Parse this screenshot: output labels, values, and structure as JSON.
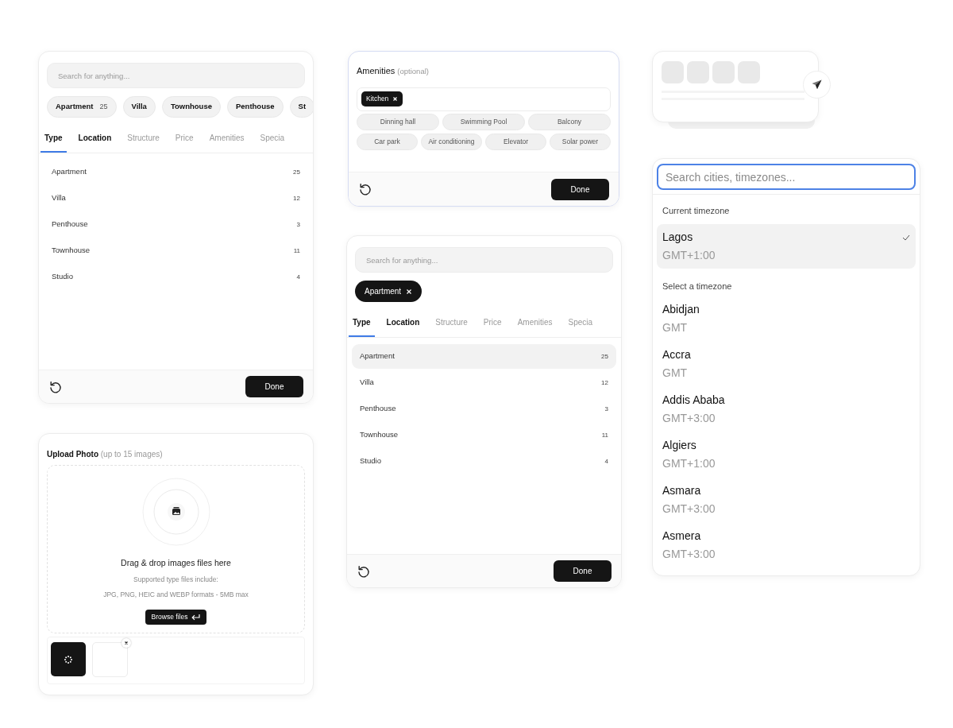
{
  "type_filter_panel": {
    "search": {
      "placeholder": "Search for anything..."
    },
    "chips": [
      {
        "label": "Apartment",
        "count": "25"
      },
      {
        "label": "Villa"
      },
      {
        "label": "Townhouse"
      },
      {
        "label": "Penthouse"
      },
      {
        "label": "St"
      }
    ],
    "tabs": [
      {
        "label": "Type",
        "selected": true,
        "muted": false
      },
      {
        "label": "Location",
        "selected": false,
        "muted": false
      },
      {
        "label": "Structure",
        "selected": false,
        "muted": true
      },
      {
        "label": "Price",
        "selected": false,
        "muted": true
      },
      {
        "label": "Amenities",
        "selected": false,
        "muted": true
      },
      {
        "label": "Specia",
        "selected": false,
        "muted": true
      }
    ],
    "items": [
      {
        "label": "Apartment",
        "count": "25",
        "selected": false
      },
      {
        "label": "Villa",
        "count": "12",
        "selected": false
      },
      {
        "label": "Penthouse",
        "count": "3",
        "selected": false
      },
      {
        "label": "Townhouse",
        "count": "11",
        "selected": false
      },
      {
        "label": "Studio",
        "count": "4",
        "selected": false
      }
    ],
    "done_button": "Done"
  },
  "upload_panel": {
    "title": "Upload Photo",
    "hint": "(up to 15 images)",
    "headline": "Drag & drop images files here",
    "note_1": "Supported type files include:",
    "note_2": "JPG, PNG, HEIC and WEBP formats - 5MB max",
    "browse_button": "Browse files",
    "thumbnails": [
      {
        "kind": "loading"
      },
      {
        "kind": "empty"
      }
    ]
  },
  "amenities_panel": {
    "title": "Amenities",
    "hint": "(optional)",
    "selected_tags": [
      {
        "label": "Kitchen"
      }
    ],
    "options": [
      {
        "label": "Dinning hall"
      },
      {
        "label": "Swimming Pool"
      },
      {
        "label": "Balcony"
      },
      {
        "label": "Car park"
      },
      {
        "label": "Air conditioning"
      },
      {
        "label": "Elevator"
      },
      {
        "label": "Solar power"
      }
    ],
    "done_button": "Done"
  },
  "selected_filter_panel": {
    "search": {
      "placeholder": "Search for anything..."
    },
    "chips": [
      {
        "label": "Apartment"
      }
    ],
    "tabs": [
      {
        "label": "Type",
        "selected": true,
        "muted": false
      },
      {
        "label": "Location",
        "selected": false,
        "muted": false
      },
      {
        "label": "Structure",
        "selected": false,
        "muted": true
      },
      {
        "label": "Price",
        "selected": false,
        "muted": true
      },
      {
        "label": "Amenities",
        "selected": false,
        "muted": true
      },
      {
        "label": "Specia",
        "selected": false,
        "muted": true
      }
    ],
    "items": [
      {
        "label": "Apartment",
        "count": "25",
        "selected": true
      },
      {
        "label": "Villa",
        "count": "12",
        "selected": false
      },
      {
        "label": "Penthouse",
        "count": "3",
        "selected": false
      },
      {
        "label": "Townhouse",
        "count": "11",
        "selected": false
      },
      {
        "label": "Studio",
        "count": "4",
        "selected": false
      }
    ],
    "done_button": "Done"
  },
  "timezone_panel": {
    "search": {
      "placeholder": "Search cities, timezones..."
    },
    "current_heading": "Current timezone",
    "current": [
      {
        "city": "Lagos",
        "offset": "GMT+1:00",
        "selected": true
      }
    ],
    "list_heading": "Select a timezone",
    "timezones": [
      {
        "city": "Abidjan",
        "offset": "GMT",
        "selected": false
      },
      {
        "city": "Accra",
        "offset": "GMT",
        "selected": false
      },
      {
        "city": "Addis Ababa",
        "offset": "GMT+3:00",
        "selected": false
      },
      {
        "city": "Algiers",
        "offset": "GMT+1:00",
        "selected": false
      },
      {
        "city": "Asmara",
        "offset": "GMT+3:00",
        "selected": false
      },
      {
        "city": "Asmera",
        "offset": "GMT+3:00",
        "selected": false
      }
    ]
  }
}
